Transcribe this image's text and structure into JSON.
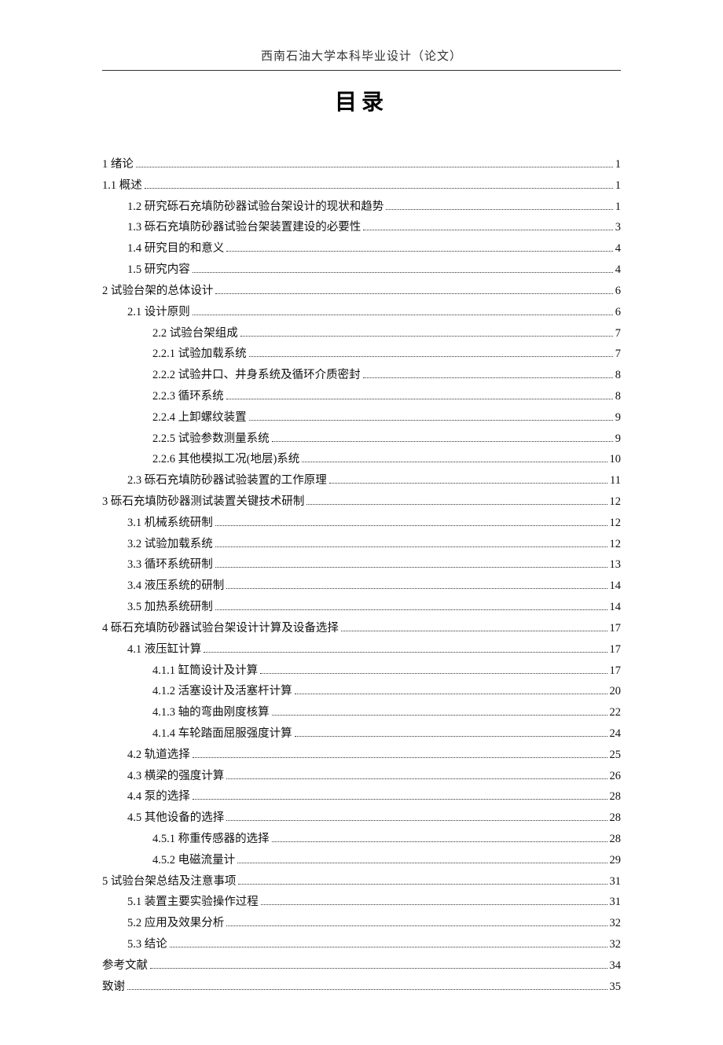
{
  "header": "西南石油大学本科毕业设计（论文）",
  "title": "目录",
  "toc": [
    {
      "level": 0,
      "label": "1 绪论",
      "page": "1"
    },
    {
      "level": 0,
      "label": "1.1 概述",
      "page": "1"
    },
    {
      "level": 1,
      "label": "1.2 研究砾石充填防砂器试验台架设计的现状和趋势",
      "page": "1"
    },
    {
      "level": 1,
      "label": "1.3 砾石充填防砂器试验台架装置建设的必要性",
      "page": "3"
    },
    {
      "level": 1,
      "label": "1.4 研究目的和意义",
      "page": "4"
    },
    {
      "level": 1,
      "label": "1.5 研究内容",
      "page": "4"
    },
    {
      "level": 0,
      "label": "2 试验台架的总体设计",
      "page": "6"
    },
    {
      "level": 1,
      "label": "2.1 设计原则",
      "page": "6"
    },
    {
      "level": 2,
      "label": "2.2 试验台架组成",
      "page": "7"
    },
    {
      "level": 2,
      "label": "2.2.1 试验加载系统",
      "page": "7"
    },
    {
      "level": 2,
      "label": "2.2.2 试验井口、井身系统及循环介质密封",
      "page": "8"
    },
    {
      "level": 2,
      "label": "2.2.3 循环系统",
      "page": "8"
    },
    {
      "level": 2,
      "label": "2.2.4 上卸螺纹装置",
      "page": "9"
    },
    {
      "level": 2,
      "label": "2.2.5 试验参数测量系统",
      "page": "9"
    },
    {
      "level": 2,
      "label": "2.2.6 其他模拟工况(地层)系统",
      "page": "10"
    },
    {
      "level": 1,
      "label": "2.3 砾石充填防砂器试验装置的工作原理",
      "page": "11"
    },
    {
      "level": 0,
      "label": "3 砾石充填防砂器测试装置关键技术研制",
      "page": "12"
    },
    {
      "level": 1,
      "label": "3.1 机械系统研制",
      "page": "12"
    },
    {
      "level": 1,
      "label": "3.2 试验加载系统",
      "page": "12"
    },
    {
      "level": 1,
      "label": "3.3 循环系统研制",
      "page": "13"
    },
    {
      "level": 1,
      "label": "3.4 液压系统的研制",
      "page": "14"
    },
    {
      "level": 1,
      "label": "3.5 加热系统研制",
      "page": "14"
    },
    {
      "level": 0,
      "label": "4 砾石充填防砂器试验台架设计计算及设备选择",
      "page": "17"
    },
    {
      "level": 1,
      "label": "4.1 液压缸计算",
      "page": "17"
    },
    {
      "level": 2,
      "label": "4.1.1 缸筒设计及计算",
      "page": "17"
    },
    {
      "level": 2,
      "label": "4.1.2 活塞设计及活塞杆计算",
      "page": "20"
    },
    {
      "level": 2,
      "label": "4.1.3 轴的弯曲刚度核算",
      "page": "22"
    },
    {
      "level": 2,
      "label": "4.1.4 车轮踏面屈服强度计算",
      "page": "24"
    },
    {
      "level": 1,
      "label": "4.2 轨道选择",
      "page": "25"
    },
    {
      "level": 1,
      "label": "4.3 横梁的强度计算",
      "page": "26"
    },
    {
      "level": 1,
      "label": "4.4 泵的选择",
      "page": "28"
    },
    {
      "level": 1,
      "label": "4.5 其他设备的选择",
      "page": "28"
    },
    {
      "level": 2,
      "label": "4.5.1 称重传感器的选择",
      "page": "28"
    },
    {
      "level": 2,
      "label": "4.5.2 电磁流量计",
      "page": "29"
    },
    {
      "level": 0,
      "label": "5 试验台架总结及注意事项",
      "page": "31"
    },
    {
      "level": 1,
      "label": "5.1 装置主要实验操作过程",
      "page": "31"
    },
    {
      "level": 1,
      "label": "5.2 应用及效果分析",
      "page": "32"
    },
    {
      "level": 1,
      "label": "5.3 结论",
      "page": "32"
    },
    {
      "level": 0,
      "label": "参考文献",
      "page": "34"
    },
    {
      "level": 0,
      "label": "致谢",
      "page": "35"
    }
  ]
}
